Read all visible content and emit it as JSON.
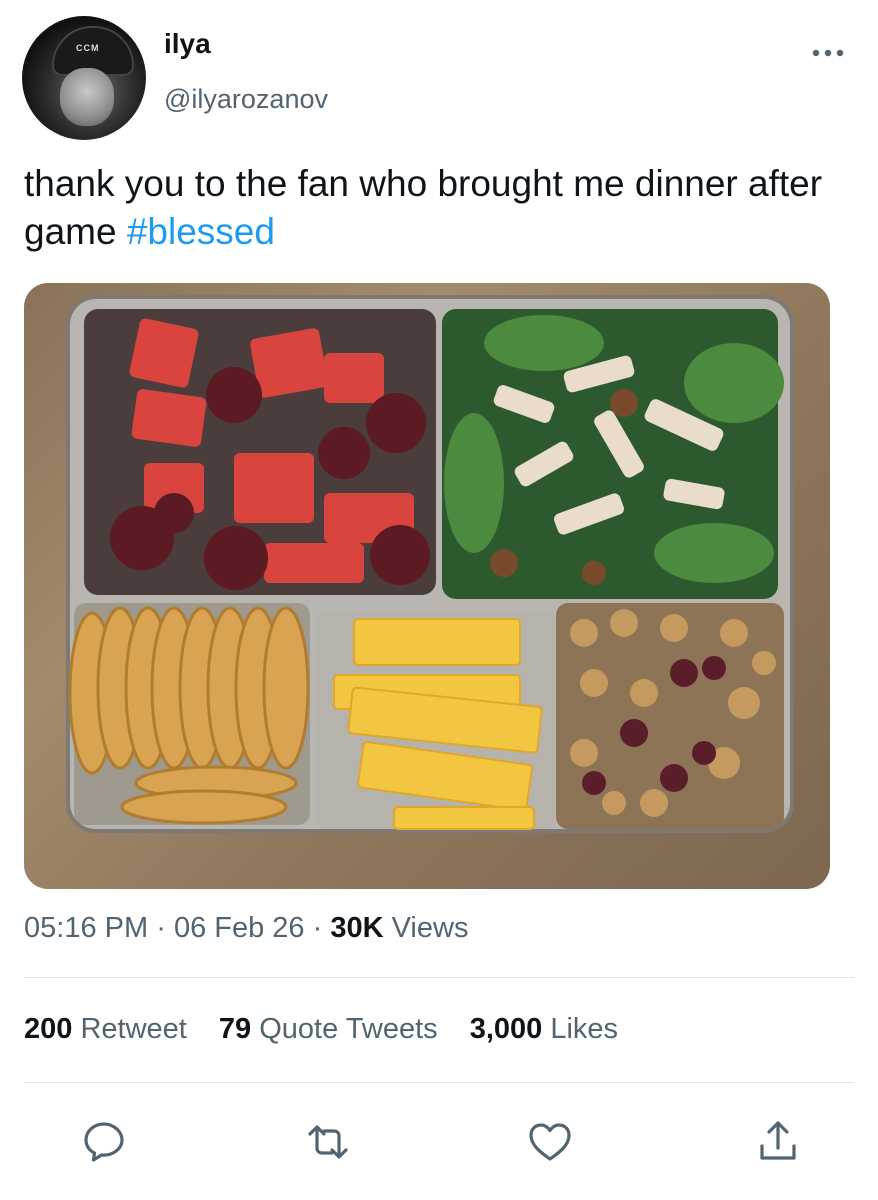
{
  "author": {
    "display_name": "ilya",
    "handle": "@ilyarozanov",
    "avatar_helmet_text": "CCM"
  },
  "tweet": {
    "text": "thank you to the fan who brought me dinner after game ",
    "hashtag": "#blessed"
  },
  "meta": {
    "time": "05:16 PM",
    "date": "06 Feb 26",
    "views_count": "30K",
    "views_label": "Views",
    "separator": "·"
  },
  "stats": {
    "retweets_count": "200",
    "retweets_label": "Retweet",
    "quotes_count": "79",
    "quotes_label": "Quote Tweets",
    "likes_count": "3,000",
    "likes_label": "Likes"
  },
  "actions": [
    "reply-icon",
    "retweet-icon",
    "like-icon",
    "share-icon"
  ],
  "colors": {
    "link": "#1d9bf0",
    "secondary_text": "#536471",
    "primary_text": "#0f1419",
    "divider": "#e1e6ea"
  }
}
